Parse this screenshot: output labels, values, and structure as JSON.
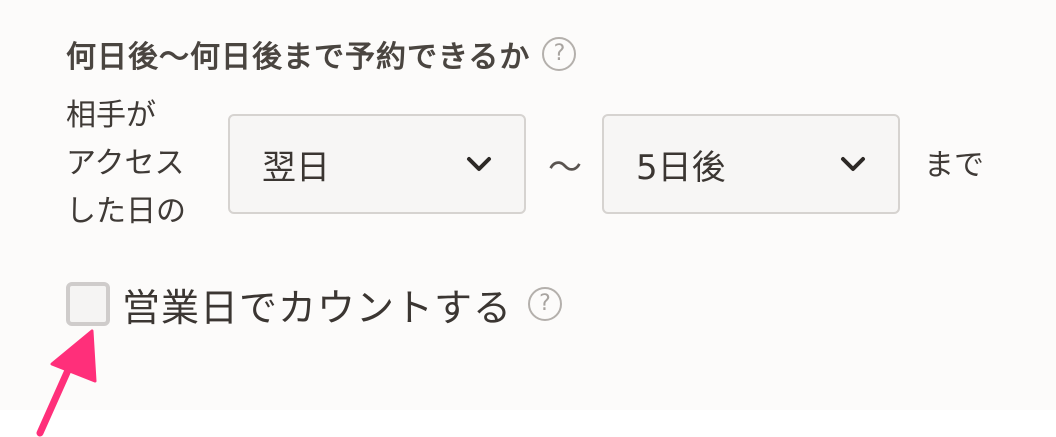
{
  "section": {
    "title": "何日後〜何日後まで予約できるか",
    "help_glyph": "?"
  },
  "range": {
    "label_lines": [
      "相手が",
      "アクセス",
      "した日の"
    ],
    "from_value": "翌日",
    "separator": "〜",
    "to_value": "5日後",
    "suffix": "まで"
  },
  "business_days": {
    "checked": false,
    "label": "営業日でカウントする",
    "help_glyph": "?"
  },
  "colors": {
    "annotation_arrow": "#ff2f7a",
    "text": "#3b3632",
    "select_border": "#d6d3d0"
  },
  "icons": {
    "select_caret": "chevron-down-icon",
    "help": "help-circle-icon",
    "annotation": "arrow-icon"
  }
}
